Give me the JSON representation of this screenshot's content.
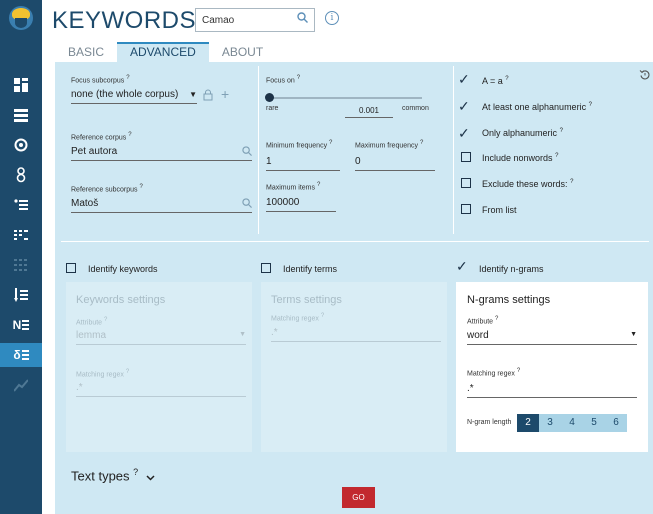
{
  "app": {
    "title": "KEYWORDS",
    "search_value": "Camao"
  },
  "sidebar": {
    "items": [
      {
        "icon": "grid-icon"
      },
      {
        "icon": "list-icon"
      },
      {
        "icon": "circle-target-icon"
      },
      {
        "icon": "people-icon"
      },
      {
        "icon": "bullet-list-icon"
      },
      {
        "icon": "columns-icon"
      },
      {
        "icon": "dotted-grid-icon"
      },
      {
        "icon": "sorted-list-icon"
      },
      {
        "icon": "n-list-icon"
      },
      {
        "icon": "delta-list-icon"
      },
      {
        "icon": "trend-icon"
      }
    ]
  },
  "tabs": [
    {
      "label": "BASIC",
      "active": false
    },
    {
      "label": "ADVANCED",
      "active": true
    },
    {
      "label": "ABOUT",
      "active": false
    }
  ],
  "focus_subcorpus": {
    "label": "Focus subcorpus",
    "value": "none (the whole corpus)"
  },
  "reference_corpus": {
    "label": "Reference corpus",
    "value": "Pet autora"
  },
  "reference_subcorpus": {
    "label": "Reference subcorpus",
    "value": "Matoš"
  },
  "focus_on": {
    "label": "Focus on",
    "left": "rare",
    "right": "common",
    "value": "0.001"
  },
  "min_freq": {
    "label": "Minimum frequency",
    "value": "1"
  },
  "max_freq": {
    "label": "Maximum frequency",
    "value": "0"
  },
  "max_items": {
    "label": "Maximum items",
    "value": "100000"
  },
  "options": [
    {
      "label": "A = a",
      "checked": true
    },
    {
      "label": "At least one alphanumeric",
      "checked": true
    },
    {
      "label": "Only alphanumeric",
      "checked": true
    },
    {
      "label": "Include nonwords",
      "checked": false
    },
    {
      "label": "Exclude these words:",
      "checked": false
    },
    {
      "label": "From list",
      "checked": false
    }
  ],
  "identify": {
    "keywords": {
      "label": "Identify keywords",
      "checked": false
    },
    "terms": {
      "label": "Identify terms",
      "checked": false
    },
    "ngrams": {
      "label": "Identify n-grams",
      "checked": true
    }
  },
  "keywords_settings": {
    "title": "Keywords settings",
    "attribute_label": "Attribute",
    "attribute_value": "lemma",
    "regex_label": "Matching regex",
    "regex_value": ".*"
  },
  "terms_settings": {
    "title": "Terms settings",
    "regex_label": "Matching regex",
    "regex_value": ".*"
  },
  "ngrams_settings": {
    "title": "N-grams settings",
    "attribute_label": "Attribute",
    "attribute_value": "word",
    "regex_label": "Matching regex",
    "regex_value": ".*",
    "length_label": "N-gram length",
    "lengths": [
      "2",
      "3",
      "4",
      "5",
      "6"
    ],
    "selected": "2"
  },
  "text_types": {
    "label": "Text types"
  },
  "go_button": {
    "label": "GO"
  },
  "colors": {
    "sidebar": "#1d4a6b",
    "panel": "#cfe8f3",
    "accent": "#2f8ac0",
    "go": "#c2292e"
  }
}
